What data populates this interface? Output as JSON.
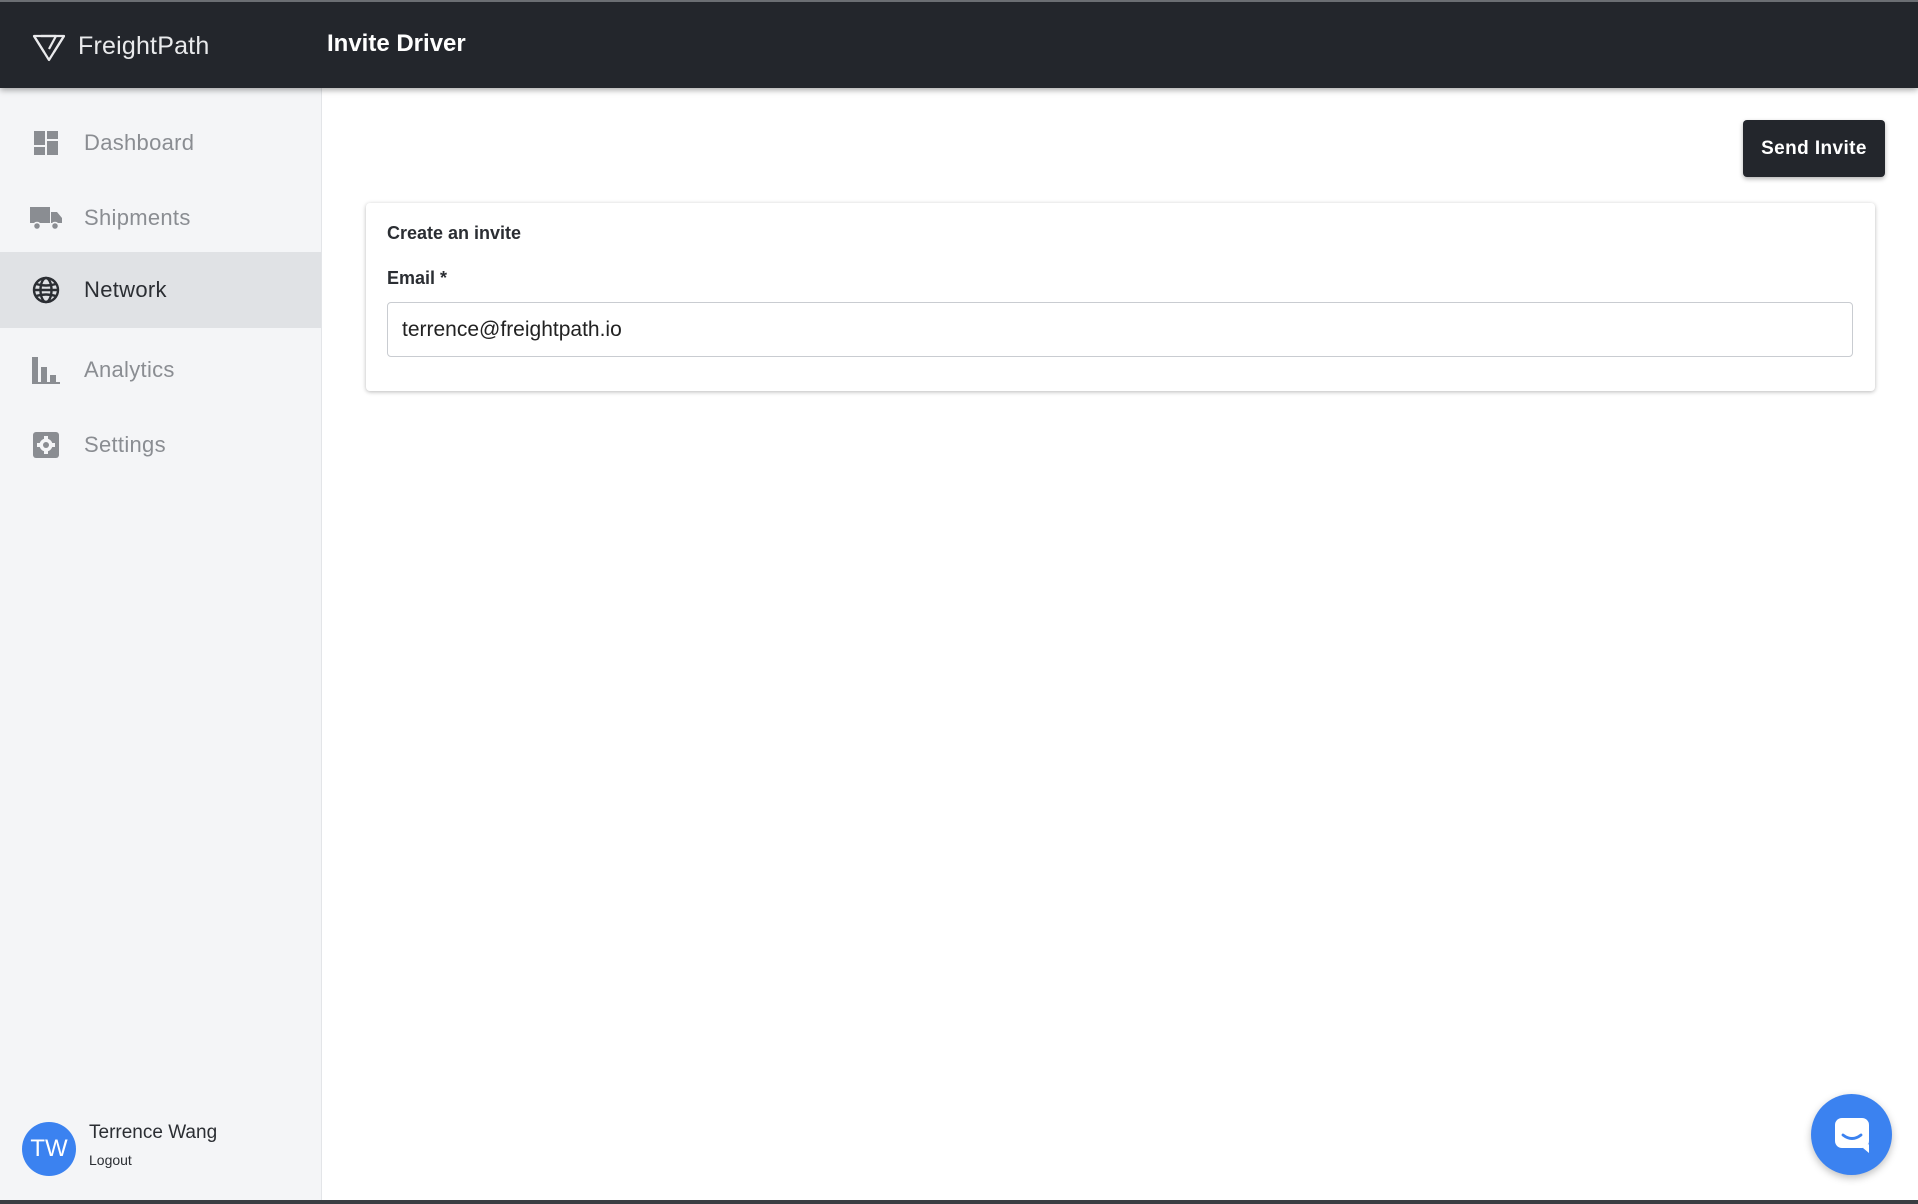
{
  "header": {
    "brand_name": "FreightPath",
    "page_title": "Invite Driver"
  },
  "sidebar": {
    "items": [
      {
        "label": "Dashboard",
        "icon": "dashboard-icon",
        "active": false
      },
      {
        "label": "Shipments",
        "icon": "truck-icon",
        "active": false
      },
      {
        "label": "Network",
        "icon": "globe-icon",
        "active": true
      },
      {
        "label": "Analytics",
        "icon": "bar-chart-icon",
        "active": false
      },
      {
        "label": "Settings",
        "icon": "gear-icon",
        "active": false
      }
    ],
    "user": {
      "initials": "TW",
      "name": "Terrence Wang",
      "logout_label": "Logout"
    }
  },
  "main": {
    "send_button_label": "Send Invite",
    "card": {
      "title": "Create an invite",
      "email_label": "Email *",
      "email_value": "terrence@freightpath.io"
    }
  },
  "colors": {
    "header_bg": "#23262c",
    "sidebar_bg": "#f4f5f7",
    "active_item_bg": "#e0e2e5",
    "accent_blue": "#3b82f0"
  }
}
